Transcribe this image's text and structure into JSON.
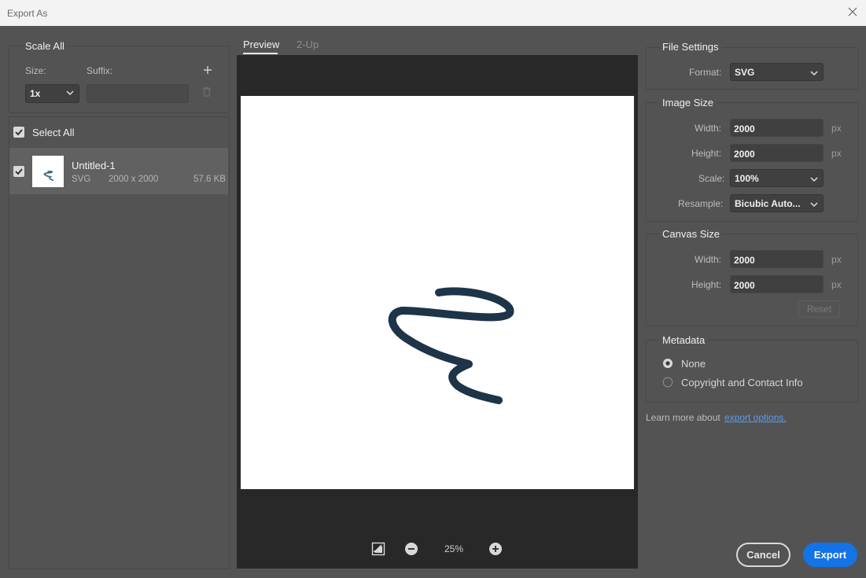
{
  "window": {
    "title": "Export As"
  },
  "scale_all": {
    "title": "Scale All",
    "size_label": "Size:",
    "suffix_label": "Suffix:",
    "size_value": "1x",
    "suffix_value": ""
  },
  "select_all": {
    "label": "Select All",
    "checked": true
  },
  "assets": [
    {
      "name": "Untitled-1",
      "format": "SVG",
      "dimensions": "2000 x 2000",
      "filesize": "57.6 KB",
      "checked": true
    }
  ],
  "preview": {
    "tabs": [
      {
        "label": "Preview",
        "active": true
      },
      {
        "label": "2-Up",
        "active": false
      }
    ],
    "zoom": "25%"
  },
  "file_settings": {
    "title": "File Settings",
    "format_label": "Format:",
    "format_value": "SVG"
  },
  "image_size": {
    "title": "Image Size",
    "width_label": "Width:",
    "width_value": "2000",
    "height_label": "Height:",
    "height_value": "2000",
    "scale_label": "Scale:",
    "scale_value": "100%",
    "resample_label": "Resample:",
    "resample_value": "Bicubic Auto...",
    "unit": "px"
  },
  "canvas_size": {
    "title": "Canvas Size",
    "width_label": "Width:",
    "width_value": "2000",
    "height_label": "Height:",
    "height_value": "2000",
    "unit": "px",
    "reset_label": "Reset"
  },
  "metadata": {
    "title": "Metadata",
    "options": [
      {
        "label": "None",
        "selected": true
      },
      {
        "label": "Copyright and Contact Info",
        "selected": false
      }
    ]
  },
  "learn_more": {
    "text": "Learn more about",
    "link": "export options."
  },
  "buttons": {
    "cancel": "Cancel",
    "export": "Export"
  },
  "colors": {
    "accent": "#1473e6",
    "link": "#5a9cf0",
    "stroke": "#1e3448",
    "panel": "#535353",
    "preview_bg": "#282828"
  }
}
